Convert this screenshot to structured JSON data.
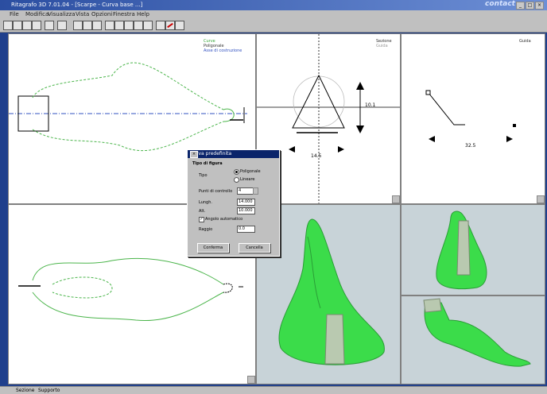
{
  "window": {
    "title": "Ritagrafo 3D 7.01.04 - [Scarpe - Curva base ...]",
    "logo": "contact"
  },
  "menu": [
    "File",
    "Modifica",
    "Visualizza",
    "Vista",
    "Opzioni",
    "Finestra",
    "Help"
  ],
  "legend_top": {
    "item1": "Curve",
    "item2": "Poligonale",
    "item3": "Asse di costruzione"
  },
  "legend_mid": {
    "item1": "Sezione",
    "item2": "Guida"
  },
  "legend_right": {
    "item1": "Guida"
  },
  "dims": {
    "mid_vertical": "10.1",
    "mid_horizontal": "14.5",
    "right_horizontal": "32.5"
  },
  "dialog": {
    "title": "Curva predefinita",
    "section": "Tipo di figura",
    "type_label": "Tipo",
    "radio1": "Poligonale",
    "radio2": "Lineare",
    "points_label": "Punti di controllo",
    "points_value": "4",
    "length_label": "Lungh.",
    "length_value": "14.000",
    "height_label": "Alt.",
    "height_value": "10.000",
    "check_label": "Angolo automatico",
    "radius_label": "Raggio",
    "radius_value": "0.0",
    "ok": "Conferma",
    "cancel": "Cancella"
  },
  "status": {
    "tab1": "Sezione",
    "tab2": "Supporto"
  },
  "colors": {
    "curve": "#4bb54b",
    "axis": "#3050c0",
    "shape": "#3bdc4a"
  }
}
